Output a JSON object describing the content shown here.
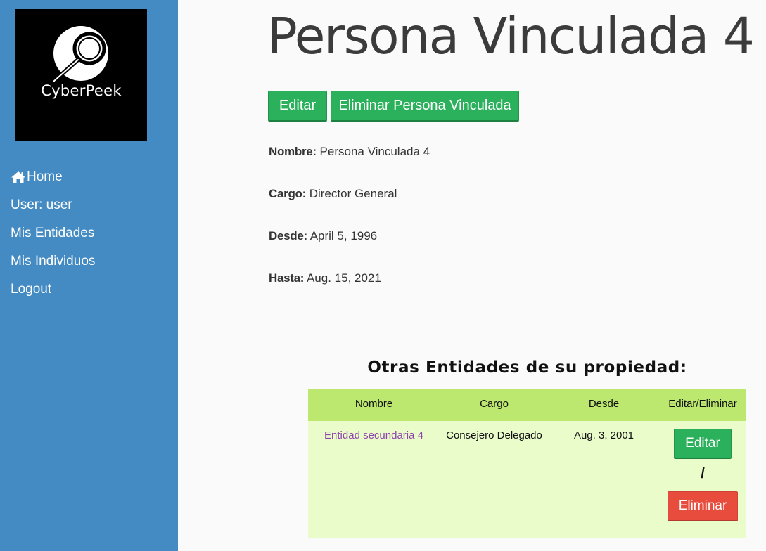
{
  "sidebar": {
    "logo_text": "CyberPeek",
    "items": [
      {
        "label": "Home",
        "icon": "home-icon"
      },
      {
        "label": "User: user"
      },
      {
        "label": "Mis Entidades"
      },
      {
        "label": "Mis Individuos"
      },
      {
        "label": "Logout"
      }
    ]
  },
  "main": {
    "title": "Persona Vinculada 4",
    "buttons": {
      "edit": "Editar",
      "delete": "Eliminar Persona Vinculada"
    },
    "fields": [
      {
        "label": "Nombre:",
        "value": "Persona Vinculada 4"
      },
      {
        "label": "Cargo:",
        "value": "Director General"
      },
      {
        "label": "Desde:",
        "value": "April 5, 1996"
      },
      {
        "label": "Hasta:",
        "value": "Aug. 15, 2021"
      }
    ]
  },
  "table": {
    "heading": "Otras Entidades de su propiedad:",
    "columns": [
      "Nombre",
      "Cargo",
      "Desde",
      "Editar/Eliminar"
    ],
    "rows": [
      {
        "nombre": "Entidad secundaria 4",
        "cargo": "Consejero Delegado",
        "desde": "Aug. 3, 2001",
        "edit_label": "Editar",
        "separator": "/",
        "delete_label": "Eliminar"
      }
    ]
  },
  "colors": {
    "sidebar": "#438bc2",
    "green_button": "#2bb05b",
    "red_button": "#e74c3c",
    "table_header": "#bde870",
    "table_body": "#ebfccb",
    "link": "#8e44ad"
  }
}
